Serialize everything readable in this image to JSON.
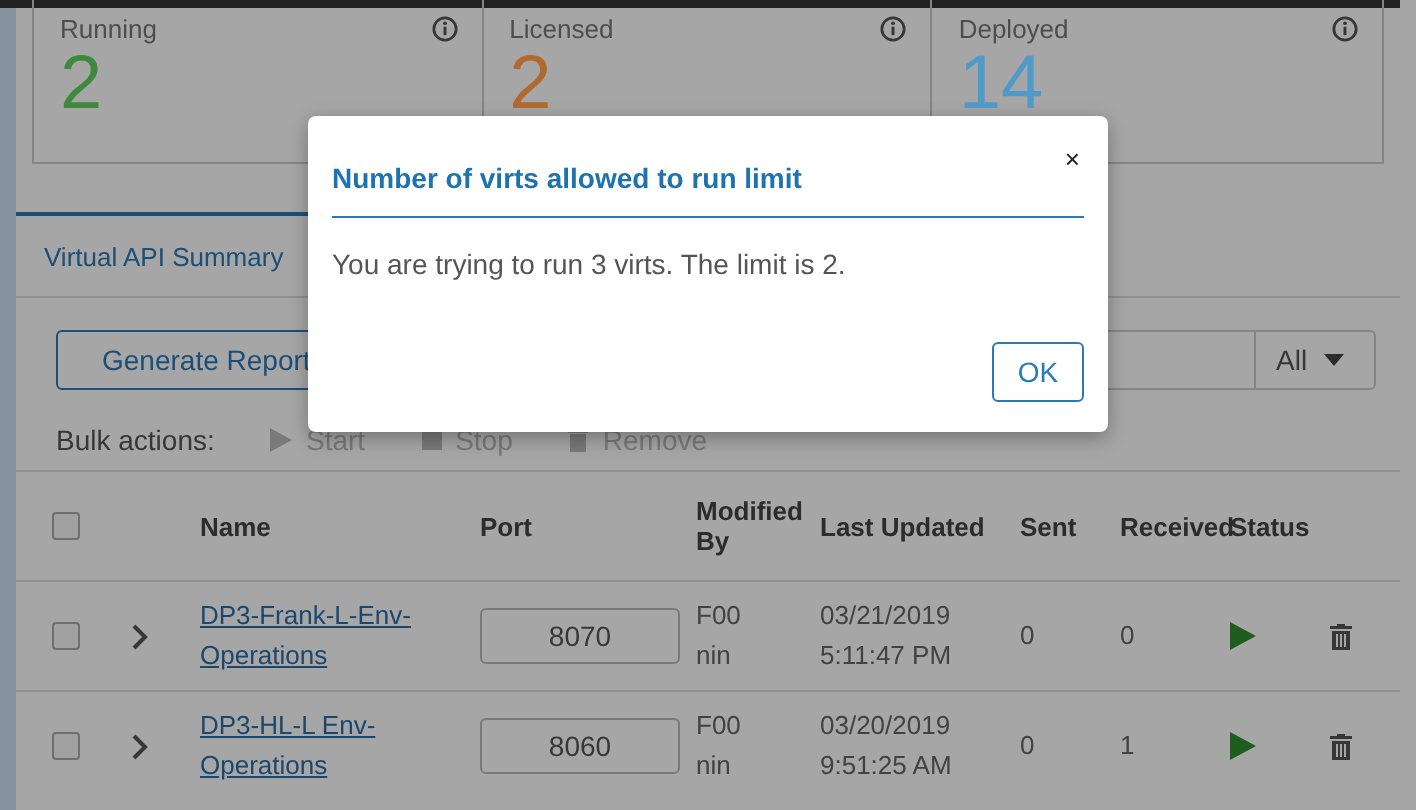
{
  "stats": [
    {
      "label": "Running",
      "value": "2",
      "color": "#3d8a3d"
    },
    {
      "label": "Licensed",
      "value": "2",
      "color": "#b06a30"
    },
    {
      "label": "Deployed",
      "value": "14",
      "color": "#4f9ac9"
    }
  ],
  "tabs": [
    {
      "label": "Virtual API Summary",
      "selected": true
    }
  ],
  "toolbar": {
    "report_button": "Generate Report",
    "filter": "All"
  },
  "bulk_actions": {
    "label": "Bulk actions:",
    "actions": [
      {
        "kind": "start",
        "label": "Start",
        "disabled": true
      },
      {
        "kind": "stop",
        "label": "Stop",
        "disabled": true
      },
      {
        "kind": "remove",
        "label": "Remove",
        "disabled": true
      }
    ]
  },
  "table": {
    "all_checked": false,
    "columns": [
      "Name",
      "Port",
      "Modified By",
      "Last Updated",
      "Sent",
      "Received",
      "Status"
    ],
    "rows": [
      {
        "checked": false,
        "name": "DP3-Frank-L-Env-Operations",
        "port": "8070",
        "modified_by": [
          "F00",
          "nin"
        ],
        "last_updated": [
          "03/21/2019",
          "5:11:47 PM"
        ],
        "sent": "0",
        "received": "0"
      },
      {
        "checked": false,
        "name": "DP3-HL-L Env-Operations",
        "port": "8060",
        "modified_by": [
          "F00",
          "nin"
        ],
        "last_updated": [
          "03/20/2019",
          "9:51:25 AM"
        ],
        "sent": "0",
        "received": "1"
      }
    ]
  },
  "dialog": {
    "title": "Number of virts allowed to run limit",
    "close": "×",
    "message": "You are trying to run 3 virts. The limit is 2.",
    "button": "OK"
  }
}
